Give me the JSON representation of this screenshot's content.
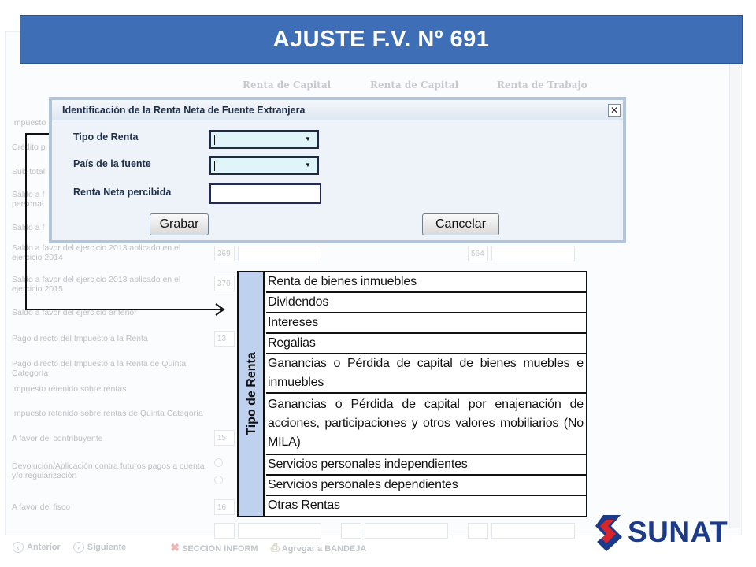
{
  "slide": {
    "title": "AJUSTE F.V. Nº 691"
  },
  "background_form": {
    "column_headers": [
      "Renta de Capital",
      "Renta de Capital",
      "Renta de Trabajo"
    ],
    "rows": [
      "Impuesto",
      "Crédito p",
      "Sub-total",
      "Saldo a f",
      "personal",
      "Saldo a f",
      "Saldo a favor del ejercicio 2013 aplicado en el ejercicio 2014",
      "Saldo a favor del ejercicio 2013 aplicado en el ejercicio 2015",
      "Saldo a favor del ejercicio anterior",
      "Pago directo del Impuesto a la Renta",
      "Pago directo del Impuesto a la Renta de Quinta Categoría",
      "Impuesto retenido sobre rentas",
      "Impuesto retenido sobre rentas de Quinta Categoría",
      "A favor del contribuyente",
      "Devolución/Aplicación contra futuros pagos a cuenta y/o regularización",
      "A favor del fisco"
    ],
    "box_codes": [
      "369",
      "564",
      "370",
      "13",
      "15",
      "16"
    ],
    "footer": {
      "prev_label": "Anterior",
      "next_label": "Siguiente",
      "section_label": "SECCION INFORM",
      "add_label": "Agregar a BANDEJA"
    }
  },
  "dialog": {
    "title": "Identificación  de la Renta Neta de Fuente Extranjera",
    "close_symbol": "✕",
    "fields": {
      "tipo_renta_label": "Tipo de Renta",
      "pais_fuente_label": "País de la fuente",
      "renta_neta_label": "Renta Neta percibida"
    },
    "tipo_renta_value": "",
    "pais_fuente_value": "",
    "renta_neta_value": "",
    "buttons": {
      "save": "Grabar",
      "cancel": "Cancelar"
    }
  },
  "tipo_renta_table": {
    "header": "Tipo de Renta",
    "options": [
      "Renta de bienes inmuebles",
      "Dividendos",
      "Intereses",
      "Regalias",
      "Ganancias o Pérdida de capital de bienes muebles e inmuebles",
      "Ganancias o Pérdida de capital por enajenación de acciones, participaciones y otros valores mobiliarios (No MILA)",
      "Servicios personales independientes",
      "Servicios personales dependientes",
      "Otras Rentas"
    ]
  },
  "logo": {
    "text": "SUNAT",
    "colors": {
      "blue": "#1c3a88",
      "red": "#d7262b"
    }
  },
  "colors": {
    "banner": "#3d6eb6",
    "table_side": "#bed2f0",
    "dialog_bg": "#eef3fa"
  }
}
